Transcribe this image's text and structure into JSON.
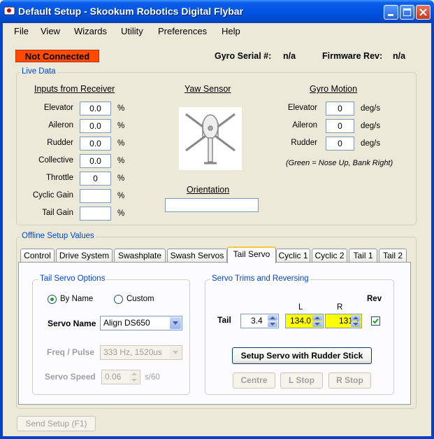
{
  "window": {
    "title": "Default Setup - Skookum Robotics Digital Flybar"
  },
  "menu": [
    "File",
    "View",
    "Wizards",
    "Utility",
    "Preferences",
    "Help"
  ],
  "status": {
    "connection": "Not Connected",
    "connection_color": "#ff4a00",
    "gyro_serial_label": "Gyro Serial #:",
    "gyro_serial_value": "n/a",
    "firmware_label": "Firmware Rev:",
    "firmware_value": "n/a"
  },
  "live_data": {
    "title": "Live Data",
    "inputs_title": "Inputs from Receiver",
    "inputs": [
      {
        "label": "Elevator",
        "value": "0.0",
        "unit": "%"
      },
      {
        "label": "Aileron",
        "value": "0.0",
        "unit": "%"
      },
      {
        "label": "Rudder",
        "value": "0.0",
        "unit": "%"
      },
      {
        "label": "Collective",
        "value": "0.0",
        "unit": "%"
      },
      {
        "label": "Throttle",
        "value": "0",
        "unit": "%"
      },
      {
        "label": "Cyclic Gain",
        "value": "",
        "unit": "%"
      },
      {
        "label": "Tail Gain",
        "value": "",
        "unit": "%"
      }
    ],
    "yaw_title": "Yaw Sensor",
    "orientation_title": "Orientation",
    "orientation_value": "",
    "motion_title": "Gyro Motion",
    "motion": [
      {
        "label": "Elevator",
        "value": "0",
        "unit": "deg/s"
      },
      {
        "label": "Aileron",
        "value": "0",
        "unit": "deg/s"
      },
      {
        "label": "Rudder",
        "value": "0",
        "unit": "deg/s"
      }
    ],
    "motion_note": "(Green = Nose Up, Bank Right)"
  },
  "offline": {
    "title": "Offline Setup Values",
    "tabs": [
      "Control",
      "Drive System",
      "Swashplate",
      "Swash Servos",
      "Tail Servo",
      "Cyclic 1",
      "Cyclic 2",
      "Tail 1",
      "Tail 2"
    ],
    "active_tab": "Tail Servo"
  },
  "tail_servo_options": {
    "title": "Tail Servo Options",
    "radio_by_name": "By Name",
    "radio_custom": "Custom",
    "selected": "By Name",
    "servo_name_label": "Servo Name",
    "servo_name_value": "Align DS650",
    "freq_label": "Freq / Pulse",
    "freq_value": "333 Hz, 1520us",
    "speed_label": "Servo Speed",
    "speed_value": "0.06",
    "speed_unit": "s/60"
  },
  "servo_trims": {
    "title": "Servo Trims and Reversing",
    "col_l": "L",
    "col_r": "R",
    "col_rev": "Rev",
    "row_label": "Tail",
    "trim_value": "3.4",
    "l_value": "134.0",
    "r_value": "131.2",
    "highlight_color": "#ffff00",
    "rev_checked": true,
    "setup_button": "Setup Servo with Rudder Stick",
    "centre_button": "Centre",
    "lstop_button": "L Stop",
    "rstop_button": "R Stop"
  },
  "footer": {
    "send_button": "Send Setup (F1)"
  }
}
